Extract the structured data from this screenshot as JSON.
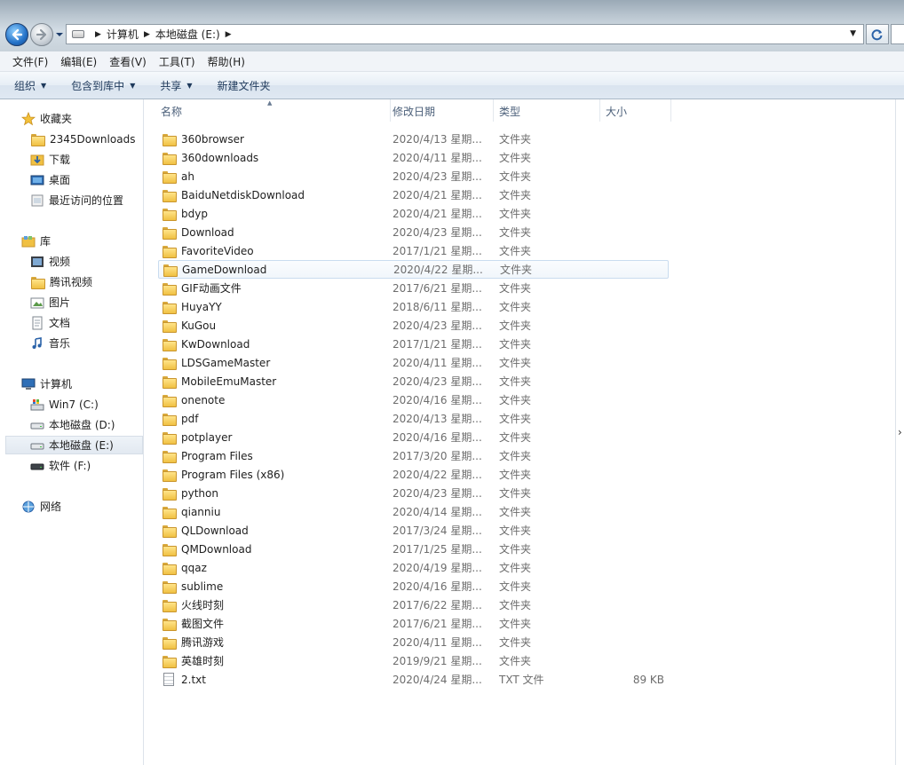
{
  "address": {
    "crumbs": [
      "计算机",
      "本地磁盘 (E:)"
    ]
  },
  "menu": [
    "文件(F)",
    "编辑(E)",
    "查看(V)",
    "工具(T)",
    "帮助(H)"
  ],
  "commands": [
    {
      "label": "组织",
      "dropdown": true
    },
    {
      "label": "包含到库中",
      "dropdown": true
    },
    {
      "label": "共享",
      "dropdown": true
    },
    {
      "label": "新建文件夹",
      "dropdown": false
    }
  ],
  "nav": {
    "favorites": {
      "label": "收藏夹",
      "items": [
        "2345Downloads",
        "下载",
        "桌面",
        "最近访问的位置"
      ]
    },
    "libraries": {
      "label": "库",
      "items": [
        "视频",
        "腾讯视频",
        "图片",
        "文档",
        "音乐"
      ]
    },
    "computer": {
      "label": "计算机",
      "items": [
        "Win7 (C:)",
        "本地磁盘 (D:)",
        "本地磁盘 (E:)",
        "软件 (F:)"
      ],
      "selected": "本地磁盘 (E:)"
    },
    "network": {
      "label": "网络"
    }
  },
  "columns": {
    "name": "名称",
    "date": "修改日期",
    "type": "类型",
    "size": "大小"
  },
  "files": [
    {
      "name": "360browser",
      "date": "2020/4/13 星期...",
      "type": "文件夹",
      "size": "",
      "icon": "folder"
    },
    {
      "name": "360downloads",
      "date": "2020/4/11 星期...",
      "type": "文件夹",
      "size": "",
      "icon": "folder"
    },
    {
      "name": "ah",
      "date": "2020/4/23 星期...",
      "type": "文件夹",
      "size": "",
      "icon": "folder"
    },
    {
      "name": "BaiduNetdiskDownload",
      "date": "2020/4/21 星期...",
      "type": "文件夹",
      "size": "",
      "icon": "folder"
    },
    {
      "name": "bdyp",
      "date": "2020/4/21 星期...",
      "type": "文件夹",
      "size": "",
      "icon": "folder"
    },
    {
      "name": "Download",
      "date": "2020/4/23 星期...",
      "type": "文件夹",
      "size": "",
      "icon": "folder"
    },
    {
      "name": "FavoriteVideo",
      "date": "2017/1/21 星期...",
      "type": "文件夹",
      "size": "",
      "icon": "folder"
    },
    {
      "name": "GameDownload",
      "date": "2020/4/22 星期...",
      "type": "文件夹",
      "size": "",
      "icon": "folder"
    },
    {
      "name": "GIF动画文件",
      "date": "2017/6/21 星期...",
      "type": "文件夹",
      "size": "",
      "icon": "folder"
    },
    {
      "name": "HuyaYY",
      "date": "2018/6/11 星期...",
      "type": "文件夹",
      "size": "",
      "icon": "folder"
    },
    {
      "name": "KuGou",
      "date": "2020/4/23 星期...",
      "type": "文件夹",
      "size": "",
      "icon": "folder"
    },
    {
      "name": "KwDownload",
      "date": "2017/1/21 星期...",
      "type": "文件夹",
      "size": "",
      "icon": "folder"
    },
    {
      "name": "LDSGameMaster",
      "date": "2020/4/11 星期...",
      "type": "文件夹",
      "size": "",
      "icon": "folder"
    },
    {
      "name": "MobileEmuMaster",
      "date": "2020/4/23 星期...",
      "type": "文件夹",
      "size": "",
      "icon": "folder"
    },
    {
      "name": "onenote",
      "date": "2020/4/16 星期...",
      "type": "文件夹",
      "size": "",
      "icon": "folder"
    },
    {
      "name": "pdf",
      "date": "2020/4/13 星期...",
      "type": "文件夹",
      "size": "",
      "icon": "folder"
    },
    {
      "name": "potplayer",
      "date": "2020/4/16 星期...",
      "type": "文件夹",
      "size": "",
      "icon": "folder"
    },
    {
      "name": "Program Files",
      "date": "2017/3/20 星期...",
      "type": "文件夹",
      "size": "",
      "icon": "folder"
    },
    {
      "name": "Program Files (x86)",
      "date": "2020/4/22 星期...",
      "type": "文件夹",
      "size": "",
      "icon": "folder"
    },
    {
      "name": "python",
      "date": "2020/4/23 星期...",
      "type": "文件夹",
      "size": "",
      "icon": "folder"
    },
    {
      "name": "qianniu",
      "date": "2020/4/14 星期...",
      "type": "文件夹",
      "size": "",
      "icon": "folder"
    },
    {
      "name": "QLDownload",
      "date": "2017/3/24 星期...",
      "type": "文件夹",
      "size": "",
      "icon": "folder"
    },
    {
      "name": "QMDownload",
      "date": "2017/1/25 星期...",
      "type": "文件夹",
      "size": "",
      "icon": "folder"
    },
    {
      "name": "qqaz",
      "date": "2020/4/19 星期...",
      "type": "文件夹",
      "size": "",
      "icon": "folder"
    },
    {
      "name": "sublime",
      "date": "2020/4/16 星期...",
      "type": "文件夹",
      "size": "",
      "icon": "folder"
    },
    {
      "name": "火线时刻",
      "date": "2017/6/22 星期...",
      "type": "文件夹",
      "size": "",
      "icon": "folder"
    },
    {
      "name": "截图文件",
      "date": "2017/6/21 星期...",
      "type": "文件夹",
      "size": "",
      "icon": "folder"
    },
    {
      "name": "腾讯游戏",
      "date": "2020/4/11 星期...",
      "type": "文件夹",
      "size": "",
      "icon": "folder"
    },
    {
      "name": "英雄时刻",
      "date": "2019/9/21 星期...",
      "type": "文件夹",
      "size": "",
      "icon": "folder"
    },
    {
      "name": "2.txt",
      "date": "2020/4/24 星期...",
      "type": "TXT 文件",
      "size": "89 KB",
      "icon": "text-file"
    }
  ],
  "hovered_file": "GameDownload"
}
